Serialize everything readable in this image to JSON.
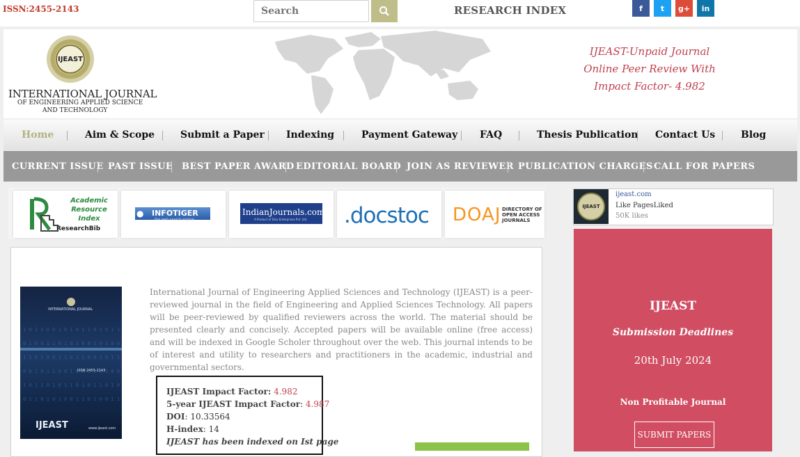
{
  "topbar": {
    "issn": "ISSN:2455-2143",
    "search_placeholder": "Search",
    "research_index": "RESEARCH INDEX",
    "social": [
      {
        "icon": "facebook-icon",
        "glyph": "f",
        "color": "#3b5998"
      },
      {
        "icon": "twitter-icon",
        "glyph": "t",
        "color": "#1da1f2"
      },
      {
        "icon": "google-plus-icon",
        "glyph": "g+",
        "color": "#dd4b39"
      },
      {
        "icon": "linkedin-icon",
        "glyph": "in",
        "color": "#0e76a8"
      }
    ]
  },
  "header": {
    "logo_text": "IJEAST",
    "journal_title_line1": "INTERNATIONAL JOURNAL",
    "journal_title_line2": "OF ENGINEERING APPLIED SCIENCE",
    "journal_title_line3": "AND TECHNOLOGY",
    "tagline": [
      "IJEAST-Unpaid Journal",
      "Online Peer Review With",
      "Impact Factor- 4.982"
    ]
  },
  "main_nav": [
    "Home",
    "Aim & Scope",
    "Submit a Paper",
    "Indexing",
    "Payment Gateway",
    "FAQ",
    "Thesis Publication",
    "Contact Us",
    "Blog"
  ],
  "sub_nav": [
    "CURRENT ISSUE",
    "PAST ISSUE",
    "BEST PAPER AWARD",
    "EDITORIAL BOARD",
    "JOIN AS REVIEWER",
    "PUBLICATION CHARGES",
    "CALL FOR PAPERS"
  ],
  "index_logos": {
    "arib": [
      "Academic",
      "Resource",
      "Index",
      "ResearchBib"
    ],
    "infotiger": "INFOTIGER",
    "infotiger_sub": "the web search engine",
    "indianjournals": "IndianJournals.com",
    "indianjournals_sub": "A Product of Diva Enterprises Pvt. Ltd.",
    "docstoc": ".docstoc",
    "doaj": "DOAJ",
    "doaj_sub": [
      "DIRECTORY OF",
      "OPEN ACCESS",
      "JOURNALS"
    ]
  },
  "content": {
    "intro": "International Journal of Engineering Applied Sciences and Technology (IJEAST) is a peer-reviewed journal in the field of Engineering and Applied Sciences Technology. All papers will be peer-reviewed by qualified reviewers across the world. The material should be presented clearly and concisely. Accepted papers will be available online (free access) and will be indexed in Google Scholer throughout over the web. This journal intends to be of interest and utility to researchers and practitioners in the academic, industrial and governmental sectors.",
    "cover": {
      "title": "INTERNATIONAL JOURNAL",
      "issn": "ISSN 2455-2143",
      "brand": "IJEAST",
      "url": "www.ijeast.com"
    },
    "impact": {
      "if_label": "IJEAST Impact Factor:",
      "if_value": "4.982",
      "if5_label": "5-year IJEAST Impact Factor",
      "if5_value": "4.987",
      "doi_label": "DOI",
      "doi_value": "10.33564",
      "hindex_label": "H-index",
      "hindex_value": "14",
      "indexed_note": "IJEAST has been indexed on Ist page"
    }
  },
  "sidebar": {
    "fb_site": "ijeast.com",
    "fb_like": "Like PagesLiked",
    "fb_likes": "50K likes",
    "box_title": "IJEAST",
    "box_sub": "Submission Deadlines",
    "box_date": "20th July 2024",
    "box_note": "Non Profitable Journal",
    "box_button": "SUBMIT PAPERS"
  }
}
